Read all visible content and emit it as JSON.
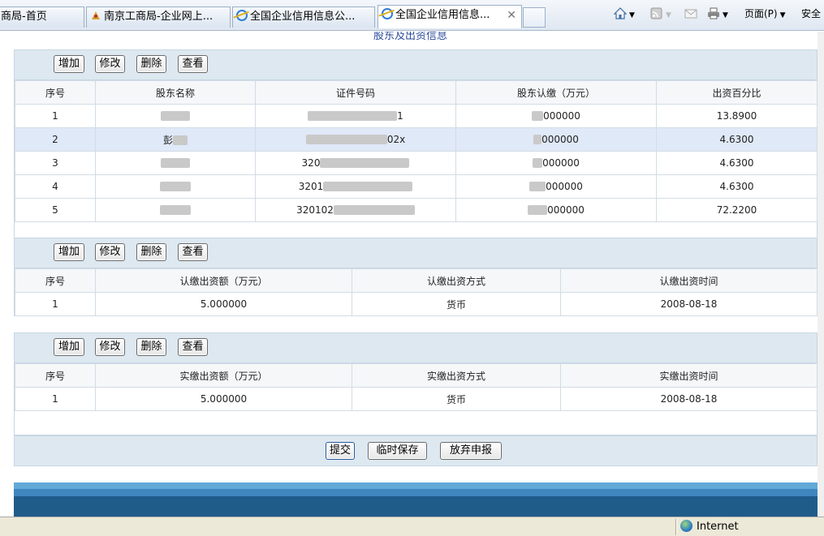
{
  "browser": {
    "tabs": [
      {
        "label": "商局-首页"
      },
      {
        "label": "南京工商局-企业网上..."
      },
      {
        "label": "全国企业信用信息公..."
      },
      {
        "label": "全国企业信用信息..."
      }
    ],
    "active_tab": 3,
    "commands": {
      "page": "页面(P)",
      "safety": "安全"
    },
    "icons": [
      "home-icon",
      "feeds-icon",
      "mail-icon",
      "print-icon"
    ]
  },
  "page": {
    "top_crop_text": "股东及出资信息",
    "shareholders": {
      "buttons": {
        "add": "增加",
        "edit": "修改",
        "delete": "删除",
        "view": "查看"
      },
      "columns": [
        "序号",
        "股东名称",
        "证件号码",
        "股东认缴（万元）",
        "出资百分比"
      ],
      "rows": [
        {
          "no": "1",
          "name_visible": "",
          "id_visible": "1",
          "amount_visible": "000000",
          "percent": "13.8900",
          "highlight": false
        },
        {
          "no": "2",
          "name_visible": "彭",
          "id_visible": "02x",
          "amount_visible": "000000",
          "percent": "4.6300",
          "highlight": true
        },
        {
          "no": "3",
          "name_visible": "",
          "id_visible": "320",
          "amount_visible": "000000",
          "percent": "4.6300",
          "highlight": false
        },
        {
          "no": "4",
          "name_visible": "",
          "id_visible": "3201",
          "amount_visible": "000000",
          "percent": "4.6300",
          "highlight": false
        },
        {
          "no": "5",
          "name_visible": "",
          "id_visible": "320102",
          "amount_visible": "000000",
          "percent": "72.2200",
          "highlight": false
        }
      ]
    },
    "subscribed": {
      "buttons": {
        "add": "增加",
        "edit": "修改",
        "delete": "删除",
        "view": "查看"
      },
      "columns": [
        "序号",
        "认缴出资额（万元）",
        "认缴出资方式",
        "认缴出资时间"
      ],
      "rows": [
        {
          "no": "1",
          "amount": "5.000000",
          "method": "货币",
          "date": "2008-08-18"
        }
      ]
    },
    "paid": {
      "buttons": {
        "add": "增加",
        "edit": "修改",
        "delete": "删除",
        "view": "查看"
      },
      "columns": [
        "序号",
        "实缴出资额（万元）",
        "实缴出资方式",
        "实缴出资时间"
      ],
      "rows": [
        {
          "no": "1",
          "amount": "5.000000",
          "method": "货币",
          "date": "2008-08-18"
        }
      ]
    },
    "footer_buttons": {
      "submit": "提交",
      "save_temp": "临时保存",
      "abandon": "放弃申报"
    }
  },
  "statusbar": {
    "zone": "Internet"
  },
  "colors": {
    "toolbar_bg": "#dde8f0",
    "highlight_row": "#e0e9f8",
    "band_dark": "#1f5c8a",
    "band_mid": "#3f86bf",
    "band_light": "#62a9d8"
  }
}
